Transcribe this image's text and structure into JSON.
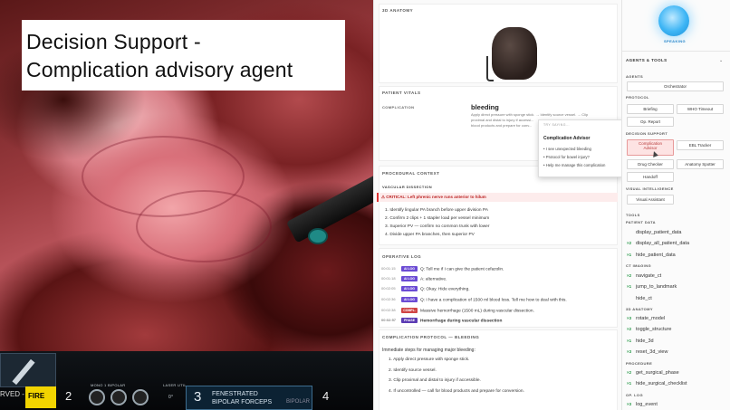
{
  "caption": {
    "line1": "Decision Support -",
    "line2": "Complication advisory agent"
  },
  "video_osd": {
    "served": "RVED -",
    "fire": "FIRE",
    "arm2": "2",
    "arm3": "3",
    "arm4": "4",
    "arm3_tool_line1": "FENESTRATED",
    "arm3_tool_line2": "BIPOLAR FORCEPS",
    "bipolar": "BIPOLAR",
    "small_left": "MONO 1 BIPOLAR",
    "small_right": "LASER UTIL",
    "angle": "0°"
  },
  "anatomy": {
    "title": "3D ANATOMY"
  },
  "vitals": {
    "title": "PATIENT VITALS",
    "complication_label": "COMPLICATION",
    "complication_value": "bleeding",
    "complication_desc_1": "Apply direct pressure with sponge stick. → Identify source vessel. → Clip",
    "complication_desc_2": "proximal and distal to injury if accessi...",
    "complication_desc_3": "blood products and prepare for conv..."
  },
  "popup": {
    "head": "TRY SAYING...",
    "title": "Complication Advisor",
    "items": [
      "I see unexpected bleeding",
      "Protocol for bowel injury?",
      "Help me manage this complication"
    ]
  },
  "context": {
    "title": "PROCEDURAL CONTEXT",
    "phase": "VASCULAR DISSECTION",
    "critical": "⚠ CRITICAL: Left phrenic nerve runs anterior to hilum",
    "steps": [
      "1. Identify lingular PA branch before upper division PA",
      "2. Confirm 2 clips + 1 stapler load per vessel minimum",
      "3. Superior PV — confirm no common trunk with lower",
      "4. Divide upper PA branches, then superior PV"
    ]
  },
  "log": {
    "title": "OPERATIVE LOG",
    "rows": [
      {
        "time": "00:01:15",
        "badge": "AI LOG",
        "kind": "ai",
        "text": "Q: Tell me if I can give the patient cefazolin."
      },
      {
        "time": "00:01:18",
        "badge": "AI LOG",
        "kind": "ai",
        "text": "A: alternative."
      },
      {
        "time": "00:02:05",
        "badge": "AI LOG",
        "kind": "ai",
        "text": "Q: Okay. Hide everything."
      },
      {
        "time": "00:02:36",
        "badge": "AI LOG",
        "kind": "ai",
        "text": "Q: I have a complication of 1500 ml blood loss. Tell me how to deal with this."
      },
      {
        "time": "00:02:38",
        "badge": "COMPL.",
        "kind": "comp",
        "text": "Massive hemorrhage (1500 mL) during vascular dissection."
      },
      {
        "time": "00:02:57",
        "badge": "PHASE",
        "kind": "phase",
        "text": "Hemorrhage during vascular dissection"
      }
    ]
  },
  "protocol": {
    "title": "COMPLICATION PROTOCOL — BLEEDING",
    "intro": "Immediate steps for managing major bleeding:",
    "steps": [
      "1. Apply direct pressure with sponge stick.",
      "2. Identify source vessel.",
      "3. Clip proximal and distal to injury if accessible.",
      "4. If uncontrolled — call for blood products and prepare for conversion."
    ]
  },
  "right": {
    "speaking": "SPEAKING",
    "agents_tools": "AGENTS & TOOLS",
    "agents_label": "AGENTS",
    "orchestrator": "Orchestrator",
    "protocol_label": "PROTOCOL",
    "briefing": "Briefing",
    "who_timeout": "WHO Timeout",
    "op_report": "Op. Report",
    "decision_label": "DECISION SUPPORT",
    "complication_advisor_1": "Complication",
    "complication_advisor_2": "Advisor",
    "ebl_tracker": "EBL Tracker",
    "drug_checker": "Drug Checker",
    "anatomy_spotter": "Anatomy Spotter",
    "handoff": "Handoff",
    "visual_label": "VISUAL INTELLIGENCE",
    "visual_assistant": "Visual Assistant",
    "tools_label": "TOOLS",
    "groups": [
      {
        "label": "PATIENT DATA",
        "tools": [
          {
            "count": "",
            "name": "display_patient_data"
          },
          {
            "count": "×2",
            "name": "display_all_patient_data"
          },
          {
            "count": "×1",
            "name": "hide_patient_data"
          }
        ]
      },
      {
        "label": "CT IMAGING",
        "tools": [
          {
            "count": "×2",
            "name": "navigate_ct"
          },
          {
            "count": "×1",
            "name": "jump_to_landmark"
          },
          {
            "count": "",
            "name": "hide_ct"
          }
        ]
      },
      {
        "label": "3D ANATOMY",
        "tools": [
          {
            "count": "×3",
            "name": "rotate_model"
          },
          {
            "count": "×2",
            "name": "toggle_structure"
          },
          {
            "count": "×1",
            "name": "hide_3d"
          },
          {
            "count": "×3",
            "name": "reset_3d_view"
          }
        ]
      },
      {
        "label": "PROCEDURE",
        "tools": [
          {
            "count": "×2",
            "name": "get_surgical_phase"
          },
          {
            "count": "×1",
            "name": "hide_surgical_checklist"
          }
        ]
      },
      {
        "label": "OP. LOG",
        "tools": [
          {
            "count": "×3",
            "name": "log_event"
          }
        ]
      }
    ]
  }
}
